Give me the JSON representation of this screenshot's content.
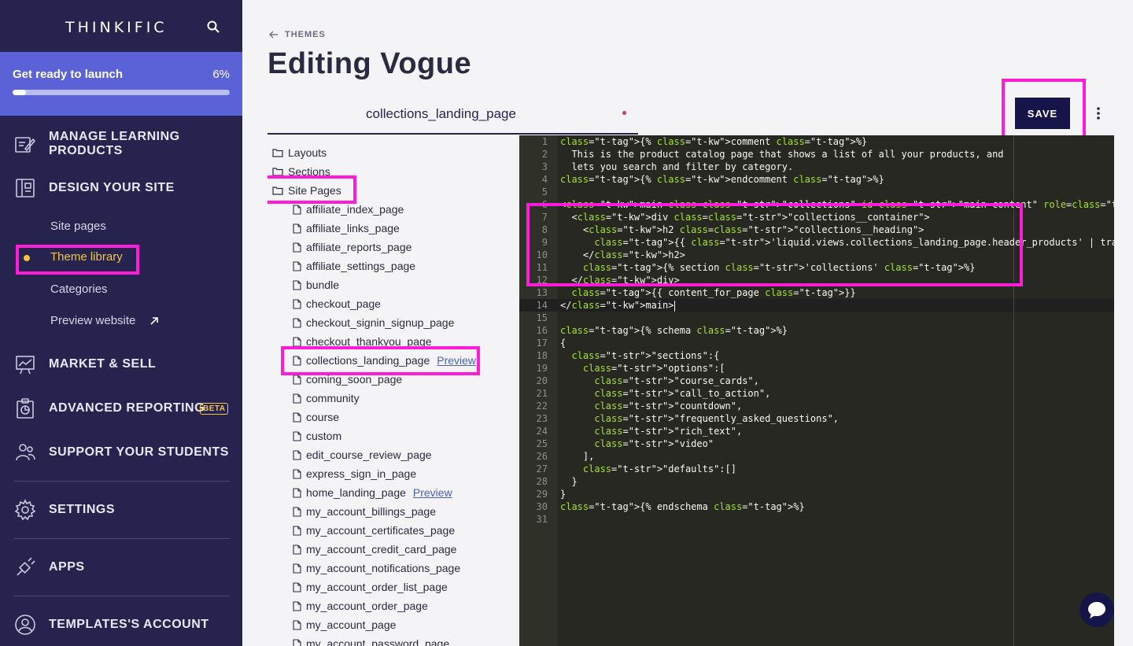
{
  "sidebar": {
    "logo": "THINKIFIC",
    "launch": {
      "title": "Get ready to launch",
      "percent_label": "6%",
      "progress": 0.06
    },
    "nav": {
      "manage": "MANAGE LEARNING PRODUCTS",
      "design": "DESIGN YOUR SITE",
      "market": "MARKET & SELL",
      "reporting": "ADVANCED REPORTING",
      "reporting_badge": "BETA",
      "support": "SUPPORT YOUR STUDENTS",
      "settings": "SETTINGS",
      "apps": "APPS",
      "account": "TEMPLATES'S ACCOUNT"
    },
    "design_sub": {
      "site_pages": "Site pages",
      "theme_library": "Theme library",
      "categories": "Categories",
      "preview_website": "Preview website"
    }
  },
  "header": {
    "back_label": "THEMES",
    "title": "Editing Vogue",
    "tab_label": "collections_landing_page",
    "save_label": "SAVE"
  },
  "tree": {
    "folders": {
      "layouts": "Layouts",
      "sections": "Sections",
      "site_pages": "Site Pages"
    },
    "files": [
      "affiliate_index_page",
      "affiliate_links_page",
      "affiliate_reports_page",
      "affiliate_settings_page",
      "bundle",
      "checkout_page",
      "checkout_signin_signup_page",
      "checkout_thankyou_page",
      "collections_landing_page",
      "coming_soon_page",
      "community",
      "course",
      "custom",
      "edit_course_review_page",
      "express_sign_in_page",
      "home_landing_page",
      "my_account_billings_page",
      "my_account_certificates_page",
      "my_account_credit_card_page",
      "my_account_notifications_page",
      "my_account_order_list_page",
      "my_account_order_page",
      "my_account_page",
      "my_account_password_page"
    ],
    "preview_label": "Preview"
  },
  "code": {
    "line_numbers": [
      "1",
      "2",
      "3",
      "4",
      "5",
      "6",
      "7",
      "8",
      "9",
      "10",
      "11",
      "12",
      "13",
      "14",
      "15",
      "16",
      "17",
      "18",
      "19",
      "20",
      "21",
      "22",
      "23",
      "24",
      "25",
      "26",
      "27",
      "28",
      "29",
      "30",
      "31"
    ],
    "lines": [
      "{% comment %}",
      "  This is the product catalog page that shows a list of all your products, and",
      "  lets you search and filter by category.",
      "{% endcomment %}",
      "",
      "<main class=\"collections\" id=\"main-content\" role=\"main\">",
      "  <div class=\"collections__container\">",
      "    <h2 class=\"collections__heading\">",
      "      {{ 'liquid.views.collections_landing_page.header_products' | translate }}",
      "    </h2>",
      "    {% section 'collections' %}",
      "  </div>",
      "  {{ content_for_page }}",
      "</main>",
      "",
      "{% schema %}",
      "{",
      "  \"sections\":{",
      "    \"options\":[",
      "      \"course_cards\",",
      "      \"call_to_action\",",
      "      \"countdown\",",
      "      \"frequently_asked_questions\",",
      "      \"rich_text\",",
      "      \"video\"",
      "    ],",
      "    \"defaults\":[]",
      "  }",
      "}",
      "{% endschema %}",
      ""
    ]
  },
  "colors": {
    "sidebar_bg": "#26244f",
    "launch_bg": "#5b62d8",
    "accent_yellow": "#f5c542",
    "highlight": "#ff1cd9",
    "save_bg": "#15154a",
    "editor_bg": "#272822"
  },
  "icons": [
    "search-icon",
    "edit-icon",
    "layout-icon",
    "chart-icon",
    "report-icon",
    "users-icon",
    "gear-icon",
    "plug-icon",
    "user-circle-icon",
    "external-link-icon",
    "arrow-left-icon",
    "kebab-icon",
    "folder-icon",
    "file-icon",
    "chat-icon"
  ]
}
